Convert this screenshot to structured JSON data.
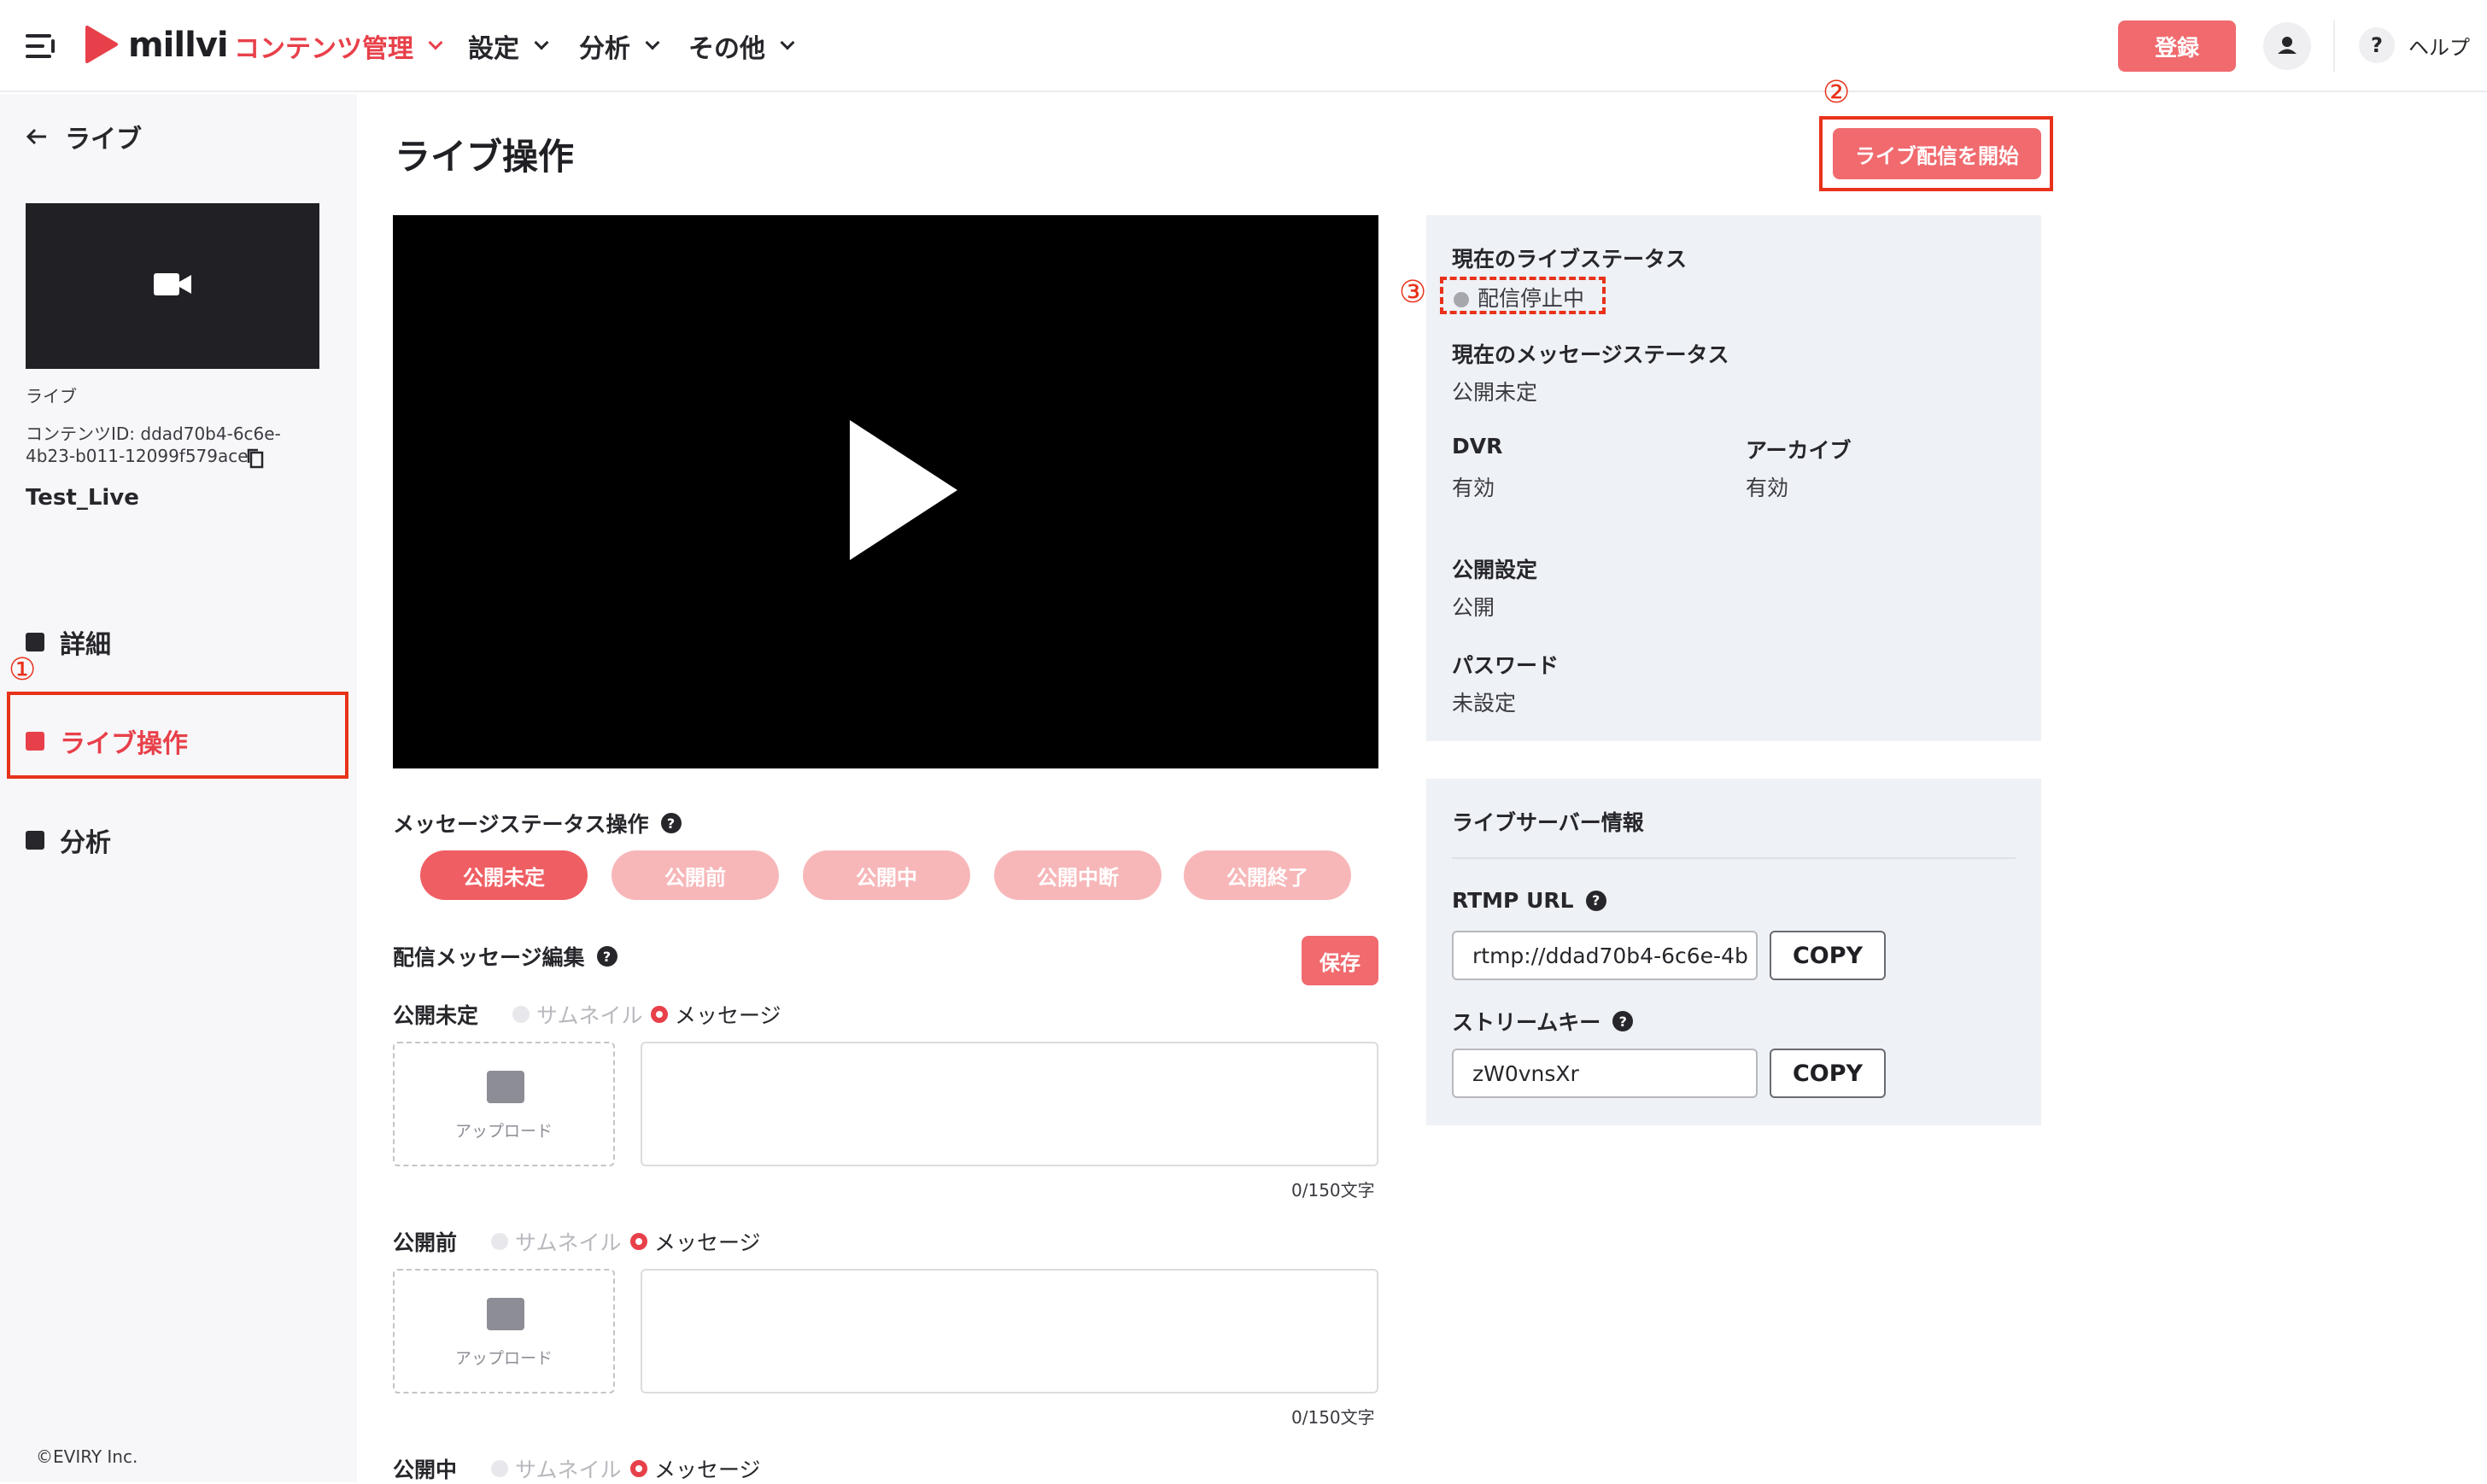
{
  "header": {
    "logo": "millvi",
    "nav": [
      {
        "label": "コンテンツ管理",
        "active": true
      },
      {
        "label": "設定",
        "active": false
      },
      {
        "label": "分析",
        "active": false
      },
      {
        "label": "その他",
        "active": false
      }
    ],
    "register_label": "登録",
    "help_label": "ヘルプ",
    "help_icon": "?"
  },
  "sidebar": {
    "back_label": "ライブ",
    "type_label": "ライブ",
    "content_id_line1": "コンテンツID: ddad70b4-6c6e-",
    "content_id_line2": "4b23-b011-12099f579ace",
    "title": "Test_Live",
    "items": [
      {
        "label": "詳細",
        "icon": "details-icon"
      },
      {
        "label": "ライブ操作",
        "icon": "live-camera-icon",
        "active": true
      },
      {
        "label": "分析",
        "icon": "chart-icon"
      }
    ],
    "copyright": "©EVIRY Inc."
  },
  "main": {
    "title": "ライブ操作",
    "start_button": "ライブ配信を開始",
    "message_status_label": "メッセージステータス操作",
    "status_buttons": [
      "公開未定",
      "公開前",
      "公開中",
      "公開中断",
      "公開終了"
    ],
    "edit_label": "配信メッセージ編集",
    "save_label": "保存",
    "message_blocks": [
      {
        "label": "公開未定",
        "option_thumb": "サムネイル",
        "option_message": "メッセージ",
        "upload": "アップロード",
        "counter": "0/150文字"
      },
      {
        "label": "公開前",
        "option_thumb": "サムネイル",
        "option_message": "メッセージ",
        "upload": "アップロード",
        "counter": "0/150文字"
      },
      {
        "label": "公開中",
        "option_thumb": "サムネイル",
        "option_message": "メッセージ"
      }
    ]
  },
  "status_panel": {
    "live_status_label": "現在のライブステータス",
    "live_status_value": "配信停止中",
    "message_status_label": "現在のメッセージステータス",
    "message_status_value": "公開未定",
    "dvr_label": "DVR",
    "dvr_value": "有効",
    "archive_label": "アーカイブ",
    "archive_value": "有効",
    "visibility_label": "公開設定",
    "visibility_value": "公開",
    "password_label": "パスワード",
    "password_value": "未設定"
  },
  "server_panel": {
    "title": "ライブサーバー情報",
    "rtmp_label": "RTMP URL",
    "rtmp_value": "rtmp://ddad70b4-6c6e-4b",
    "stream_key_label": "ストリームキー",
    "stream_key_value": "zW0vnsXr",
    "copy_label": "COPY"
  },
  "annotations": [
    "①",
    "②",
    "③"
  ],
  "colors": {
    "accent": "#e8404a",
    "button": "#f06a6e",
    "annotation": "#e8321a",
    "panel": "#eef1f5"
  }
}
